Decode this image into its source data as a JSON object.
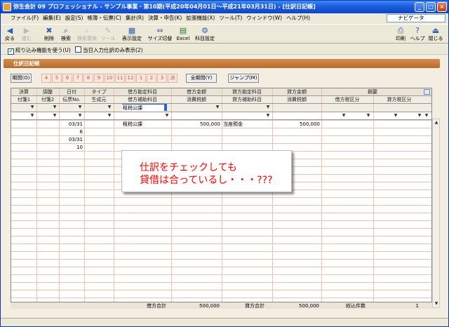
{
  "window": {
    "title": "弥生会計 09 プロフェッショナル - サンプル事業・第10期(平成20年04月01日～平成21年03月31日) - [仕訳日記帳]"
  },
  "menu": [
    "ファイル(F)",
    "編集(E)",
    "設定(S)",
    "帳簿・伝票(C)",
    "集計(R)",
    "決算・申告(K)",
    "拡張機能(X)",
    "ツール(T)",
    "ウィンドウ(W)",
    "ヘルプ(H)"
  ],
  "navi": "ナビゲータ",
  "toolbar": {
    "back": "戻る",
    "forward": "進む",
    "delete": "削除",
    "search": "検索",
    "search_replace": "検索置換",
    "journal": "ツール",
    "display": "表示設定",
    "size": "サイズ切替",
    "excel": "Excel",
    "account": "科目設定",
    "print": "印刷",
    "help": "ヘルプ",
    "close": "閉じる"
  },
  "options": {
    "narrow": "絞り込み機能を使う(U)",
    "today": "当日入力仕訳のみ表示(2)"
  },
  "section_title": "仕訳日記帳",
  "period": {
    "label": "期間(O)",
    "months": [
      "4",
      "5",
      "6",
      "7",
      "8",
      "9",
      "10",
      "11",
      "12",
      "1",
      "2",
      "3",
      "決"
    ],
    "all": "全期間(Y)",
    "jump": "ジャンプ(M)"
  },
  "headers": {
    "kessan": "決算",
    "chosei": "調整",
    "date": "日付",
    "type": "タイプ",
    "debit_acct": "借方勘定科目",
    "debit_amt": "借方金額",
    "credit_acct": "貸方勘定科目",
    "credit_amt": "貸方金額",
    "tekiyo": "摘要",
    "fusen1": "付箋1",
    "fusen2": "付箋2",
    "denpyo": "伝票No.",
    "seisei": "生成元",
    "debit_sub": "借方補助科目",
    "debit_tax": "消費税額",
    "credit_sub": "貸方補助科目",
    "credit_tax": "消費税額",
    "debit_taxcat": "借方税区分",
    "credit_taxcat": "貸方税区分"
  },
  "input_row": {
    "debit_acct": "租税公課"
  },
  "rows": [
    {
      "date": "03/31",
      "debit_acct": "租税公課",
      "debit_amt": "500,000",
      "credit_acct": "当座預金",
      "credit_amt": "500,000"
    }
  ],
  "row_denpyo": "6",
  "row2_date": "03/31",
  "row2_denpyo": "10",
  "footer": {
    "debit_total_label": "借方合計",
    "debit_total": "500,000",
    "credit_total_label": "貸方合計",
    "credit_total": "500,000",
    "count_label": "絞込件数",
    "count": "1"
  },
  "callout": {
    "line1": "仕訳をチェックしても",
    "line2": "貸借は合っているし・・・???"
  },
  "colors": {
    "titlebar": "#0a46c8",
    "section_header": "#c87a3a",
    "callout_text": "#ff0000",
    "selected_cell": "#2d5fd2"
  }
}
